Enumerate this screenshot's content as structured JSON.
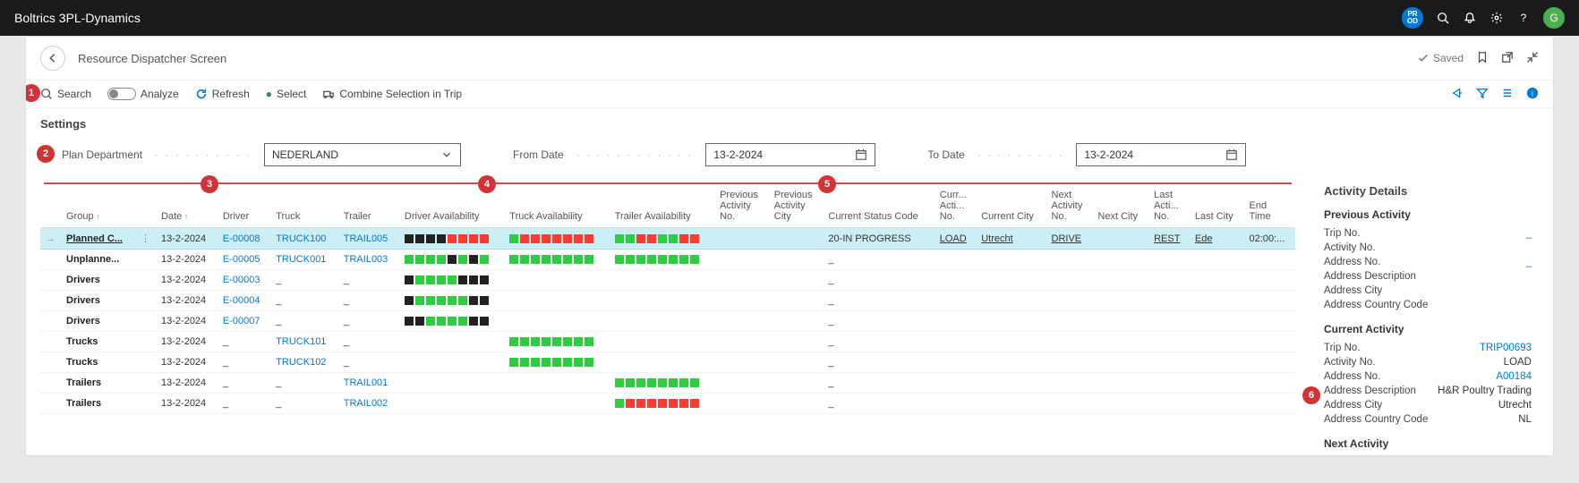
{
  "app": {
    "title": "Boltrics 3PL-Dynamics"
  },
  "header": {
    "prod_badge": "PR\nOD",
    "avatar": "G",
    "page_title": "Resource Dispatcher Screen",
    "saved": "Saved"
  },
  "toolbar": {
    "search": "Search",
    "analyze": "Analyze",
    "refresh": "Refresh",
    "select": "Select",
    "combine": "Combine Selection in Trip"
  },
  "settings": {
    "heading": "Settings",
    "plan_department_label": "Plan Department",
    "plan_department_value": "NEDERLAND",
    "from_date_label": "From Date",
    "from_date_value": "13-2-2024",
    "to_date_label": "To Date",
    "to_date_value": "13-2-2024"
  },
  "columns": {
    "group": "Group",
    "date": "Date",
    "driver": "Driver",
    "truck": "Truck",
    "trailer": "Trailer",
    "driver_avail": "Driver Availability",
    "truck_avail": "Truck Availability",
    "trailer_avail": "Trailer Availability",
    "prev_act_no": "Previous\nActivity\nNo.",
    "prev_act_city": "Previous\nActivity\nCity",
    "status": "Current Status Code",
    "curr_act_no": "Curr...\nActi...\nNo.",
    "curr_city": "Current City",
    "next_act_no": "Next\nActivity\nNo.",
    "next_city": "Next City",
    "last_act_no": "Last\nActi...\nNo.",
    "last_city": "Last City",
    "end_time": "End\nTime"
  },
  "rows": [
    {
      "selected": true,
      "group": "Planned C...",
      "date": "13-2-2024",
      "driver": "E-00008",
      "truck": "TRUCK100",
      "trailer": "TRAIL005",
      "driver_avail": "kkkkrrrr",
      "truck_avail": "grrrrrrr",
      "trailer_avail": "ggrrggrr",
      "status": "20-IN PROGRESS",
      "curr_act": "LOAD",
      "curr_city": "Utrecht",
      "next_act": "DRIVE",
      "last_act": "REST",
      "last_city": "Ede",
      "end_time": "02:00:..."
    },
    {
      "group": "Unplanne...",
      "date": "13-2-2024",
      "driver": "E-00005",
      "truck": "TRUCK001",
      "trailer": "TRAIL003",
      "driver_avail": "ggggkgkg",
      "truck_avail": "gggggggg",
      "trailer_avail": "gggggggg",
      "status": "_"
    },
    {
      "group": "Drivers",
      "date": "13-2-2024",
      "driver": "E-00003",
      "truck": "_",
      "trailer": "_",
      "driver_avail": "kggggkkk",
      "status": "_"
    },
    {
      "group": "Drivers",
      "date": "13-2-2024",
      "driver": "E-00004",
      "truck": "_",
      "trailer": "_",
      "driver_avail": "kgggggkk",
      "status": "_"
    },
    {
      "group": "Drivers",
      "date": "13-2-2024",
      "driver": "E-00007",
      "truck": "_",
      "trailer": "_",
      "driver_avail": "kkggggkk",
      "status": "_"
    },
    {
      "group": "Trucks",
      "date": "13-2-2024",
      "driver": "_",
      "truck": "TRUCK101",
      "trailer": "_",
      "truck_avail": "gggggggg",
      "status": "_"
    },
    {
      "group": "Trucks",
      "date": "13-2-2024",
      "driver": "_",
      "truck": "TRUCK102",
      "trailer": "_",
      "truck_avail": "gggggggg",
      "status": "_"
    },
    {
      "group": "Trailers",
      "date": "13-2-2024",
      "driver": "_",
      "truck": "_",
      "trailer": "TRAIL001",
      "trailer_avail": "gggggggg",
      "status": "_"
    },
    {
      "group": "Trailers",
      "date": "13-2-2024",
      "driver": "_",
      "truck": "_",
      "trailer": "TRAIL002",
      "trailer_avail": "grrrrrrr",
      "status": "_"
    }
  ],
  "details": {
    "heading": "Activity Details",
    "prev": {
      "heading": "Previous Activity",
      "trip_no_label": "Trip No.",
      "trip_no": "_",
      "act_no_label": "Activity No.",
      "addr_no_label": "Address No.",
      "addr_no": "_",
      "addr_desc_label": "Address Description",
      "addr_city_label": "Address City",
      "addr_cc_label": "Address Country Code"
    },
    "curr": {
      "heading": "Current Activity",
      "trip_no_label": "Trip No.",
      "trip_no": "TRIP00693",
      "act_no_label": "Activity No.",
      "act_no": "LOAD",
      "addr_no_label": "Address No.",
      "addr_no": "A00184",
      "addr_desc_label": "Address Description",
      "addr_desc": "H&R Poultry Trading",
      "addr_city_label": "Address City",
      "addr_city": "Utrecht",
      "addr_cc_label": "Address Country Code",
      "addr_cc": "NL"
    },
    "next": {
      "heading": "Next Activity"
    }
  },
  "callouts": [
    "1",
    "2",
    "3",
    "4",
    "5",
    "6"
  ]
}
